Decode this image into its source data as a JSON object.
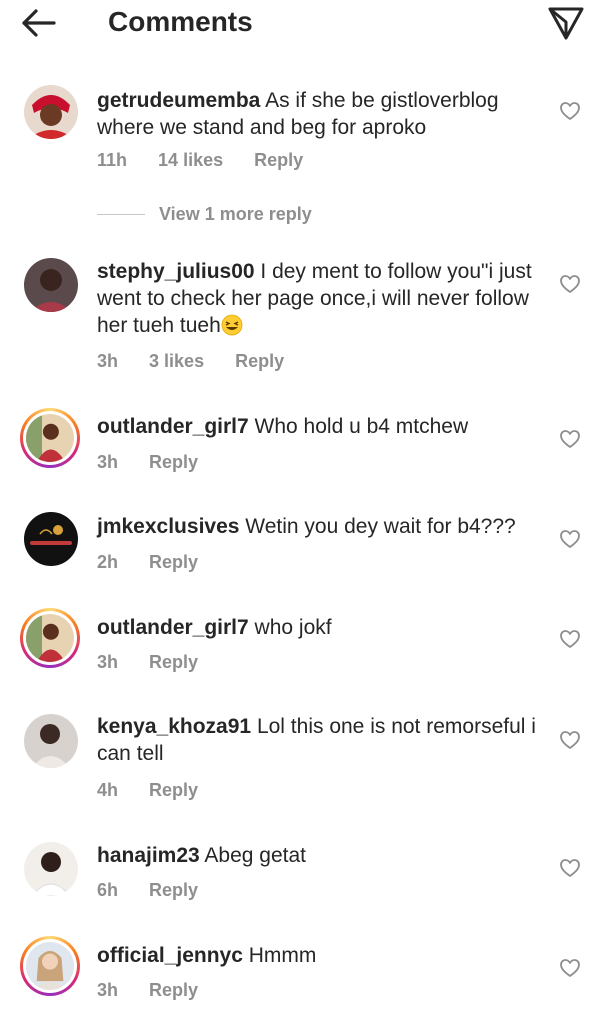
{
  "header": {
    "title": "Comments",
    "back_icon": "back-arrow-icon",
    "direct_icon": "send-icon"
  },
  "comments": [
    {
      "username": "getrudeumemba",
      "text": "As if she be gistloverblog where we stand and beg for aproko",
      "time": "11h",
      "likes": "14 likes",
      "reply": "Reply"
    },
    {
      "username": "stephy_julius00",
      "text": "I dey ment to follow you\"i just went to check her page once,i will never follow her tueh tueh",
      "emoji": "grinning-squinting-face-emoji",
      "time": "3h",
      "likes": "3 likes",
      "reply": "Reply"
    },
    {
      "username": "outlander_girl7",
      "text": "Who hold u b4 mtchew",
      "time": "3h",
      "reply": "Reply"
    },
    {
      "username": "jmkexclusives",
      "text": "Wetin you dey wait for b4???",
      "time": "2h",
      "reply": "Reply"
    },
    {
      "username": "outlander_girl7",
      "text": "who jokf",
      "time": "3h",
      "reply": "Reply"
    },
    {
      "username": "kenya_khoza91",
      "text": "Lol this one is not remorseful  i can tell",
      "time": "4h",
      "reply": "Reply"
    },
    {
      "username": "hanajim23",
      "text": "Abeg getat",
      "time": "6h",
      "reply": "Reply"
    },
    {
      "username": "official_jennyc",
      "text": "Hmmm",
      "time": "3h",
      "reply": "Reply"
    }
  ],
  "view_more_replies": "View 1 more reply",
  "colors": {
    "text": "#262626",
    "secondary": "#8e8e8e",
    "story_ring": [
      "#feda75",
      "#fa7e1e",
      "#d62976",
      "#962fbf"
    ]
  }
}
